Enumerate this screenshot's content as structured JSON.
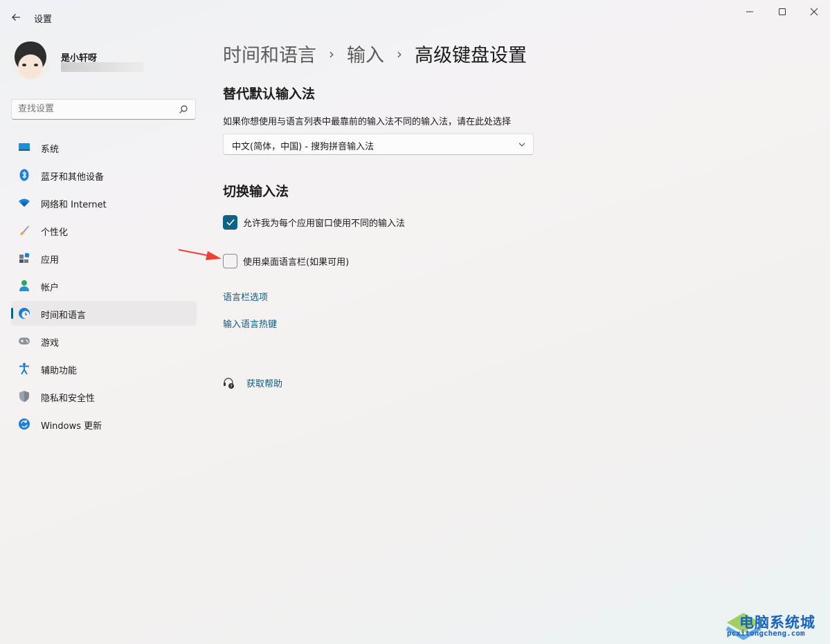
{
  "window": {
    "title": "设置"
  },
  "profile": {
    "name": "是小轩呀"
  },
  "search": {
    "placeholder": "查找设置"
  },
  "sidebar": {
    "items": [
      {
        "label": "系统",
        "icon": "system-icon"
      },
      {
        "label": "蓝牙和其他设备",
        "icon": "bluetooth-icon"
      },
      {
        "label": "网络和 Internet",
        "icon": "wifi-icon"
      },
      {
        "label": "个性化",
        "icon": "brush-icon"
      },
      {
        "label": "应用",
        "icon": "apps-icon"
      },
      {
        "label": "帐户",
        "icon": "account-icon"
      },
      {
        "label": "时间和语言",
        "icon": "time-language-icon",
        "active": true
      },
      {
        "label": "游戏",
        "icon": "gamepad-icon"
      },
      {
        "label": "辅助功能",
        "icon": "accessibility-icon"
      },
      {
        "label": "隐私和安全性",
        "icon": "shield-icon"
      },
      {
        "label": "Windows 更新",
        "icon": "update-icon"
      }
    ]
  },
  "breadcrumb": {
    "level1": "时间和语言",
    "level2": "输入",
    "current": "高级键盘设置",
    "separator": "›"
  },
  "override": {
    "heading": "替代默认输入法",
    "description": "如果你想使用与语言列表中最靠前的输入法不同的输入法，请在此处选择",
    "selected": "中文(简体，中国) - 搜狗拼音输入法"
  },
  "switching": {
    "heading": "切换输入法",
    "per_app_label": "允许我为每个应用窗口使用不同的输入法",
    "per_app_checked": true,
    "language_bar_label": "使用桌面语言栏(如果可用)",
    "language_bar_checked": false,
    "language_bar_options_link": "语言栏选项",
    "hotkeys_link": "输入语言热键"
  },
  "help": {
    "label": "获取帮助"
  },
  "watermark": {
    "title": "电脑系统城",
    "url": "pcxitongcheng.com"
  },
  "colors": {
    "accent": "#0e6283",
    "link": "#0b5b7d",
    "arrow": "#e8423a"
  }
}
